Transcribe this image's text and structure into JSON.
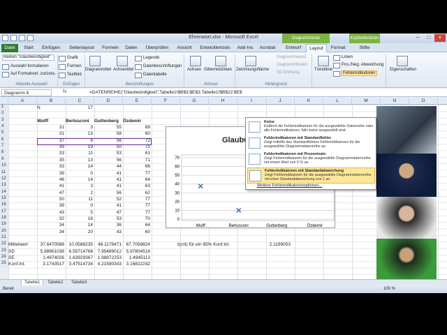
{
  "window": {
    "title": "Ehrenwort.xlsx - Microsoft Excel",
    "context_tabs": [
      "Diagrammtools",
      "Kopfzeilentools"
    ],
    "min_symbol": "−",
    "max_symbol": "□",
    "close_symbol": "×"
  },
  "tabs": [
    "Datei",
    "Start",
    "Einfügen",
    "Seitenlayout",
    "Formeln",
    "Daten",
    "Überprüfen",
    "Ansicht",
    "Entwicklertools",
    "Add-Ins",
    "Acrobat",
    "Entwurf",
    "Layout",
    "Format",
    "Stifte"
  ],
  "active_tab": "Layout",
  "ribbon": {
    "selection": {
      "dropdown": "Reihen \"Glaubwürdigkeit\"",
      "format": "Auswahl formatieren",
      "reset": "Auf Formatvorl. zurücks.",
      "group": "Aktuelle Auswahl"
    },
    "insert": {
      "grafik": "Grafik",
      "formen": "Formen",
      "textfeld": "Textfeld",
      "group": "Einfügen"
    },
    "labels": {
      "diagrammtitel": "Diagrammtitel",
      "achsentitel": "Achsentitel",
      "legende": "Legende",
      "datenbeschriftungen": "Datenbeschriftungen",
      "datentabelle": "Datentabelle",
      "group": "Beschriftungen"
    },
    "axes": {
      "achsen": "Achsen",
      "gitternetzlinien": "Gitternetzlinien",
      "group": "Achsen"
    },
    "background": {
      "zeichnungsflaeche": "Zeichnungsfläche",
      "diagrammwand": "Diagrammwand",
      "diagrammboden": "Diagrammboden",
      "3d_drehung": "3D-Drehung",
      "group": "Hintergrund"
    },
    "analysis": {
      "trendlinie": "Trendlinie",
      "linien": "Linien",
      "posneg": "Pos./Neg. Abweichung",
      "fehlerindikatoren": "Fehlerindikatoren"
    },
    "properties": {
      "eigenschaften": "Eigenschaften"
    }
  },
  "formula_bar": {
    "name_box": "Diagramm 6",
    "formula": "=DATENREIHE(\"Glaubwürdigkeit\";Tabelle1!$B$3:$E$3;Tabelle1!$B$22:$E$"
  },
  "columns": [
    "A",
    "B",
    "C",
    "D",
    "E",
    "F",
    "G",
    "H",
    "I",
    "J",
    "K",
    "L",
    "M",
    "N",
    "O"
  ],
  "rows": [
    "1",
    "2",
    "3",
    "4",
    "5",
    "6",
    "7",
    "8",
    "9",
    "10",
    "11",
    "12",
    "13",
    "14",
    "15",
    "16",
    "17",
    "18",
    "19",
    "20",
    "21",
    "22",
    "23",
    "24",
    "25"
  ],
  "cells": {
    "n_label": "N",
    "n_value": "17",
    "headers": [
      "Wulff",
      "Berlusconi",
      "Guttenberg",
      "Özdemir"
    ],
    "data": [
      [
        31,
        3,
        55,
        69
      ],
      [
        31,
        13,
        58,
        60
      ],
      [
        37,
        8,
        56,
        72
      ],
      [
        39,
        19,
        50,
        72
      ],
      [
        33,
        11,
        53,
        61
      ],
      [
        35,
        13,
        56,
        71
      ],
      [
        33,
        14,
        44,
        66
      ],
      [
        39,
        0,
        41,
        77
      ],
      [
        48,
        14,
        41,
        64
      ],
      [
        41,
        3,
        41,
        63
      ],
      [
        47,
        2,
        56,
        62
      ],
      [
        50,
        11,
        52,
        77
      ],
      [
        39,
        0,
        41,
        77
      ],
      [
        43,
        5,
        47,
        77
      ],
      [
        32,
        16,
        53,
        70
      ],
      [
        34,
        14,
        36,
        64
      ],
      [
        34,
        20,
        43,
        60
      ]
    ],
    "mittelwert_label": "Mittelwert",
    "mittelwert": [
      "37.6470588",
      "10.0588235",
      "48.1176471",
      "67.7058824"
    ],
    "sd_label": "SD",
    "sd": [
      "5.98961038",
      "6.55714768",
      "7.95489012",
      "5.97804518"
    ],
    "se_label": "SE",
    "se": [
      "1.4974026",
      "1.63929367",
      "1.98872253",
      "1.4945113"
    ],
    "konf_label": "Konf.Int.",
    "konf": [
      "3.1743517",
      "3.47514734",
      "4.21590343",
      "3.16822242"
    ],
    "tcrit_label": "t(crit) für ein 95% Konf.int.",
    "tcrit_value": "2.1199053"
  },
  "chart_data": {
    "type": "scatter",
    "title": "Glaubw",
    "categories": [
      "Wulff",
      "Berlusconi",
      "Guttenberg",
      "Özdemir"
    ],
    "values": [
      37.6,
      10.1,
      48.1,
      67.7
    ],
    "ylim": [
      0,
      70
    ],
    "yticks": [
      0,
      10,
      20,
      30,
      40,
      50,
      60,
      70
    ],
    "grid": true,
    "marker_color": "#4a78b4"
  },
  "dropdown": {
    "items": [
      {
        "title": "Keine",
        "desc": "Entfernt die Fehlerindikatoren für die ausgewählte Datenreihe oder alle Fehlerindikatoren, falls keine ausgewählt sind."
      },
      {
        "title": "Fehlerindikatoren mit Standardfehler",
        "desc": "Zeigt mithilfe des Standardfehlers Fehlerindikatoren für die ausgewählte Diagrammdatenreihe an."
      },
      {
        "title": "Fehlerindikatoren mit Prozentsatz",
        "desc": "Zeigt Fehlerindikatoren für die ausgewählte Diagrammdatenreihe mit einem Wert von 5 % an."
      },
      {
        "title": "Fehlerindikatoren mit Standardabweichung",
        "desc": "Zeigt Fehlerindikatoren für die ausgewählte Diagrammdatenreihe mit einer Standardabweichung von 1 an."
      }
    ],
    "more": "Weitere Fehlerindikatorenoptionen..."
  },
  "sheet_tabs": [
    "Tabelle1",
    "Tabelle2",
    "Tabelle3"
  ],
  "status": {
    "ready": "Bereit",
    "zoom": "100 %"
  },
  "colors": {
    "file_tab": "#2e7d32",
    "context_tab": "#7cb342",
    "highlight": "#fde89a",
    "header_border": "#7030a0"
  }
}
